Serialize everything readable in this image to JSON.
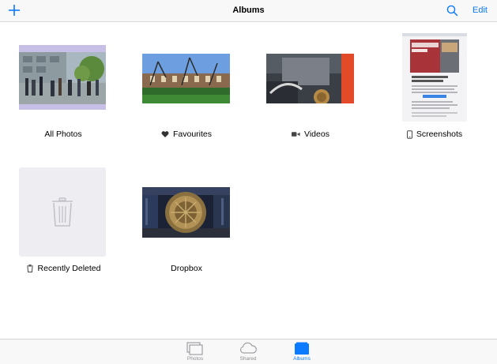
{
  "navbar": {
    "title": "Albums",
    "edit_label": "Edit",
    "add_icon": "plus-icon",
    "search_icon": "search-icon"
  },
  "albums": [
    {
      "name": "All Photos",
      "icon": "none"
    },
    {
      "name": "Favourites",
      "icon": "heart-icon"
    },
    {
      "name": "Videos",
      "icon": "video-camera-icon"
    },
    {
      "name": "Screenshots",
      "icon": "phone-icon"
    },
    {
      "name": "Recently Deleted",
      "icon": "trash-icon"
    },
    {
      "name": "Dropbox",
      "icon": "none"
    }
  ],
  "screenshot_thumb_text": "Mr Bodie that captures the spirit of London",
  "tabs": [
    {
      "label": "Photos",
      "icon": "photos-stack-icon",
      "active": false
    },
    {
      "label": "Shared",
      "icon": "cloud-icon",
      "active": false
    },
    {
      "label": "Albums",
      "icon": "folder-icon",
      "active": true
    }
  ],
  "colors": {
    "accent": "#0a7aff",
    "tab_inactive": "#8e8e93",
    "bar_background": "#f8f8f8"
  }
}
